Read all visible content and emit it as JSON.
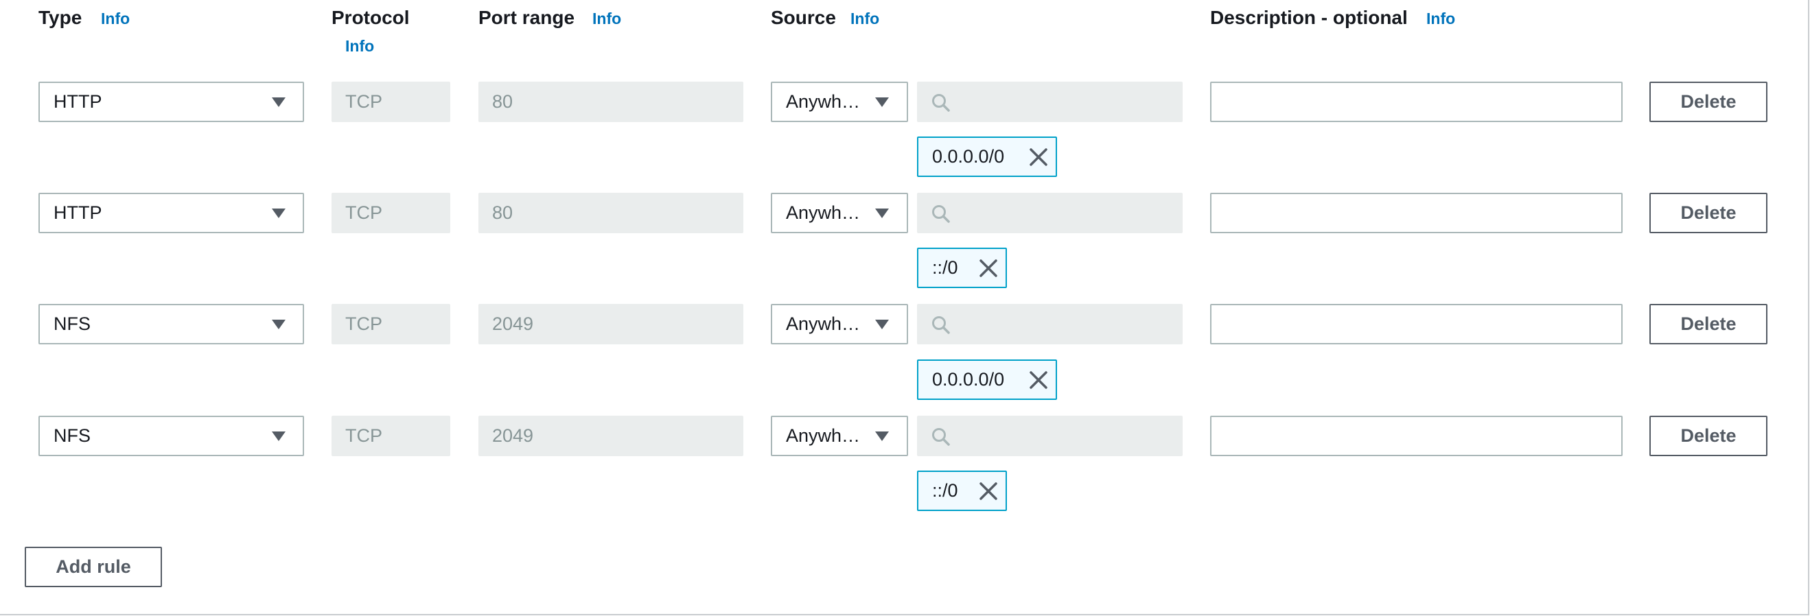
{
  "header": {
    "type_label": "Type",
    "protocol_label": "Protocol",
    "port_range_label": "Port range",
    "source_label": "Source",
    "description_label": "Description - optional",
    "info_link": "Info"
  },
  "rules": [
    {
      "type": "HTTP",
      "protocol": "TCP",
      "port_range": "80",
      "source_type": "Anywh…",
      "cidr": "0.0.0.0/0",
      "description": "",
      "delete_label": "Delete"
    },
    {
      "type": "HTTP",
      "protocol": "TCP",
      "port_range": "80",
      "source_type": "Anywh…",
      "cidr": "::/0",
      "description": "",
      "delete_label": "Delete"
    },
    {
      "type": "NFS",
      "protocol": "TCP",
      "port_range": "2049",
      "source_type": "Anywh…",
      "cidr": "0.0.0.0/0",
      "description": "",
      "delete_label": "Delete"
    },
    {
      "type": "NFS",
      "protocol": "TCP",
      "port_range": "2049",
      "source_type": "Anywh…",
      "cidr": "::/0",
      "description": "",
      "delete_label": "Delete"
    }
  ],
  "add_rule_label": "Add rule",
  "colors": {
    "link": "#0073bb",
    "token_border": "#00a1c9",
    "token_bg": "#f1faff",
    "readonly_bg": "#eaeded",
    "border": "#aab7b8",
    "button_text": "#545b64"
  },
  "icons": {
    "dropdown": "caret-down-icon",
    "search": "search-icon",
    "remove_token": "close-icon"
  }
}
